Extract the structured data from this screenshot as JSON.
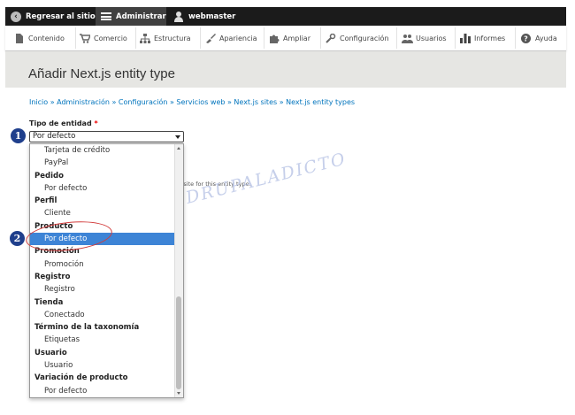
{
  "toolbar": {
    "back_label": "Regresar al sitio",
    "admin_label": "Administrar",
    "user_label": "webmaster"
  },
  "tray": {
    "items": [
      {
        "label": "Contenido",
        "icon": "page-icon"
      },
      {
        "label": "Comercio",
        "icon": "cart-icon"
      },
      {
        "label": "Estructura",
        "icon": "sitemap-icon"
      },
      {
        "label": "Apariencia",
        "icon": "paintbrush-icon"
      },
      {
        "label": "Ampliar",
        "icon": "puzzle-icon"
      },
      {
        "label": "Configuración",
        "icon": "wrench-icon"
      },
      {
        "label": "Usuarios",
        "icon": "people-icon"
      },
      {
        "label": "Informes",
        "icon": "bar-chart-icon"
      },
      {
        "label": "Ayuda",
        "icon": "help-icon"
      }
    ]
  },
  "page": {
    "title": "Añadir Next.js entity type",
    "breadcrumb": "Inicio » Administración » Configuración » Servicios web » Next.js sites » Next.js entity types"
  },
  "form": {
    "entity_type_label": "Tipo de entidad",
    "required_mark": "*",
    "selected_value": "Por defecto",
    "description": "w site for this entity type."
  },
  "dropdown": {
    "options": [
      {
        "text": "Tarjeta de crédito",
        "kind": "option"
      },
      {
        "text": "PayPal",
        "kind": "option"
      },
      {
        "text": "Pedido",
        "kind": "group"
      },
      {
        "text": "Por defecto",
        "kind": "option"
      },
      {
        "text": "Perfil",
        "kind": "group"
      },
      {
        "text": "Cliente",
        "kind": "option"
      },
      {
        "text": "Producto",
        "kind": "group"
      },
      {
        "text": "Por defecto",
        "kind": "option",
        "selected": true
      },
      {
        "text": "Promoción",
        "kind": "group"
      },
      {
        "text": "Promoción",
        "kind": "option"
      },
      {
        "text": "Registro",
        "kind": "group"
      },
      {
        "text": "Registro",
        "kind": "option"
      },
      {
        "text": "Tienda",
        "kind": "group"
      },
      {
        "text": "Conectado",
        "kind": "option"
      },
      {
        "text": "Término de la taxonomía",
        "kind": "group"
      },
      {
        "text": "Etiquetas",
        "kind": "option"
      },
      {
        "text": "Usuario",
        "kind": "group"
      },
      {
        "text": "Usuario",
        "kind": "option"
      },
      {
        "text": "Variación de producto",
        "kind": "group"
      },
      {
        "text": "Por defecto",
        "kind": "option"
      }
    ]
  },
  "callouts": {
    "one": "1",
    "two": "2"
  },
  "watermark": {
    "text": "DRUPALADICTO",
    "letter": "D"
  },
  "colors": {
    "toolbar_bg": "#1b1b1b",
    "link": "#0074bd",
    "selected_option": "#3d84d6",
    "badge": "#1f3f8c",
    "highlight_ellipse": "#d23b3b"
  }
}
